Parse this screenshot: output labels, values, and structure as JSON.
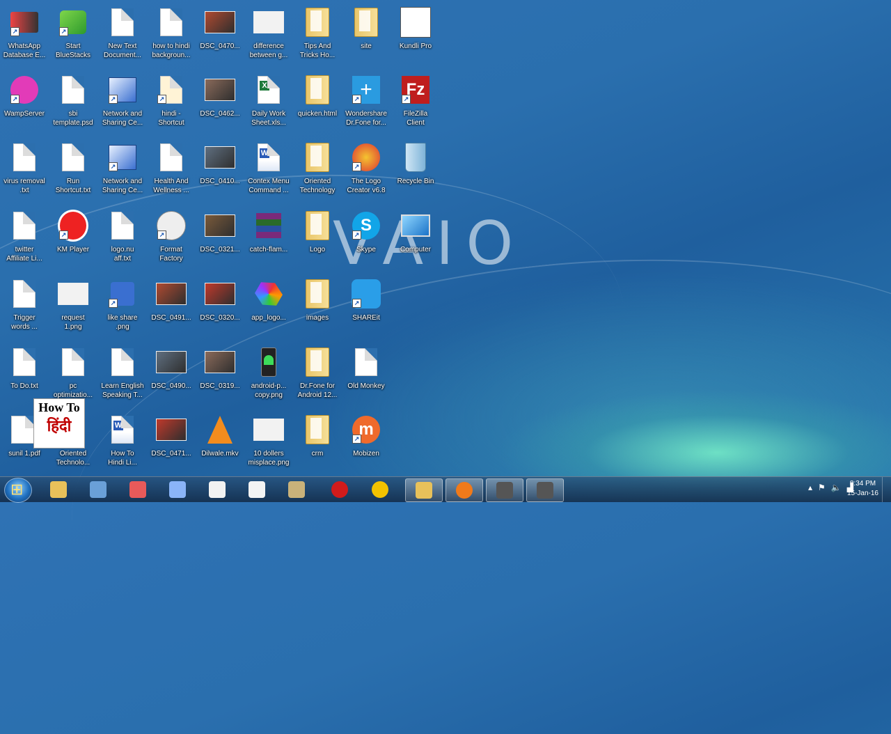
{
  "wallpaper": {
    "brand": "VAIO"
  },
  "icons": [
    {
      "label": "WhatsApp\nDatabase E...",
      "icon": "whatsapp-db-icon"
    },
    {
      "label": "Start\nBlueStacks",
      "icon": "bluestacks-icon"
    },
    {
      "label": "New Text\nDocument...",
      "icon": "text-document-icon"
    },
    {
      "label": "how to hindi\nbackgroun...",
      "icon": "document-icon"
    },
    {
      "label": "DSC_0470...",
      "icon": "photo-icon"
    },
    {
      "label": "difference\nbetween g...",
      "icon": "image-icon"
    },
    {
      "label": "Tips And\nTricks Ho...",
      "icon": "folder-icon"
    },
    {
      "label": "site",
      "icon": "folder-icon"
    },
    {
      "label": "Kundli Pro",
      "icon": "kundli-icon"
    },
    {
      "label": "WampServer",
      "icon": "wampserver-icon"
    },
    {
      "label": "sbi\ntemplate.psd",
      "icon": "psd-file-icon"
    },
    {
      "label": "Network and\nSharing Ce...",
      "icon": "network-icon"
    },
    {
      "label": "hindi -\nShortcut",
      "icon": "shortcut-icon"
    },
    {
      "label": "DSC_0462...",
      "icon": "photo-icon"
    },
    {
      "label": "Daily Work\nSheet.xls...",
      "icon": "excel-icon"
    },
    {
      "label": "quicken.html",
      "icon": "folder-icon"
    },
    {
      "label": "Wondershare\nDr.Fone for...",
      "icon": "drfone-icon"
    },
    {
      "label": "FileZilla\nClient",
      "icon": "filezilla-icon"
    },
    {
      "label": "virus removal\n.txt",
      "icon": "text-document-icon"
    },
    {
      "label": "Run\nShortcut.txt",
      "icon": "text-document-icon"
    },
    {
      "label": "Network and\nSharing Ce...",
      "icon": "network-icon"
    },
    {
      "label": "Health And\nWellness ...",
      "icon": "document-icon"
    },
    {
      "label": "DSC_0410...",
      "icon": "photo-icon"
    },
    {
      "label": "Contex Menu\nCommand ...",
      "icon": "word-icon"
    },
    {
      "label": "Oriented\nTechnology",
      "icon": "folder-icon"
    },
    {
      "label": "The Logo\nCreator v6.8",
      "icon": "logo-creator-icon"
    },
    {
      "label": "Recycle Bin",
      "icon": "recycle-bin-icon"
    },
    {
      "label": "twitter\nAffiliate Li...",
      "icon": "document-icon"
    },
    {
      "label": "KM Player",
      "icon": "kmplayer-icon"
    },
    {
      "label": "logo.nu\naff.txt",
      "icon": "text-document-icon"
    },
    {
      "label": "Format\nFactory",
      "icon": "format-factory-icon"
    },
    {
      "label": "DSC_0321...",
      "icon": "photo-icon"
    },
    {
      "label": "catch-flam...",
      "icon": "winrar-icon"
    },
    {
      "label": "Logo",
      "icon": "folder-icon"
    },
    {
      "label": "Skype",
      "icon": "skype-icon"
    },
    {
      "label": "Computer",
      "icon": "computer-icon"
    },
    {
      "label": "Trigger\nwords ...",
      "icon": "document-icon"
    },
    {
      "label": "request\n1.png",
      "icon": "image-icon"
    },
    {
      "label": "like share\n.png",
      "icon": "like-share-icon"
    },
    {
      "label": "DSC_0491...",
      "icon": "photo-icon"
    },
    {
      "label": "DSC_0320...",
      "icon": "photo-icon"
    },
    {
      "label": "app_logo...",
      "icon": "app-logo-icon"
    },
    {
      "label": "images",
      "icon": "folder-icon"
    },
    {
      "label": "SHAREit",
      "icon": "shareit-icon"
    },
    {
      "label": "To Do.txt",
      "icon": "text-document-icon"
    },
    {
      "label": "pc\noptimizatio...",
      "icon": "document-icon"
    },
    {
      "label": "Learn English\nSpeaking T...",
      "icon": "document-icon"
    },
    {
      "label": "DSC_0490...",
      "icon": "photo-icon"
    },
    {
      "label": "DSC_0319...",
      "icon": "photo-icon"
    },
    {
      "label": "android-p...\ncopy.png",
      "icon": "android-icon"
    },
    {
      "label": "Dr.Fone for\nAndroid 12...",
      "icon": "folder-icon"
    },
    {
      "label": "Old Monkey",
      "icon": "old-monkey-icon"
    },
    {
      "label": "sunil 1.pdf",
      "icon": "pdf-icon"
    },
    {
      "label": "Oriented\nTechnolo...",
      "icon": "document-icon"
    },
    {
      "label": "How To\nHindi Li...",
      "icon": "word-icon"
    },
    {
      "label": "DSC_0471...",
      "icon": "photo-icon"
    },
    {
      "label": "Dilwale.mkv",
      "icon": "vlc-icon"
    },
    {
      "label": "10 dollers\nmisplace.png",
      "icon": "image-icon"
    },
    {
      "label": "crm",
      "icon": "folder-icon"
    },
    {
      "label": "Mobizen",
      "icon": "mobizen-icon"
    }
  ],
  "overlay": {
    "line1": "How To",
    "line2": "हिंदी"
  },
  "taskbar": {
    "apps": [
      "explorer-icon",
      "tools-icon",
      "paint-icon",
      "link-icon",
      "tally-icon",
      "notepad-icon",
      "paint-brush-icon",
      "opera-icon",
      "chrome-icon",
      "folder-window-icon",
      "firefox-icon",
      "window-thumb-icon",
      "window-thumb-icon"
    ],
    "time": "8:34 PM",
    "date": "15-Jan-16"
  }
}
